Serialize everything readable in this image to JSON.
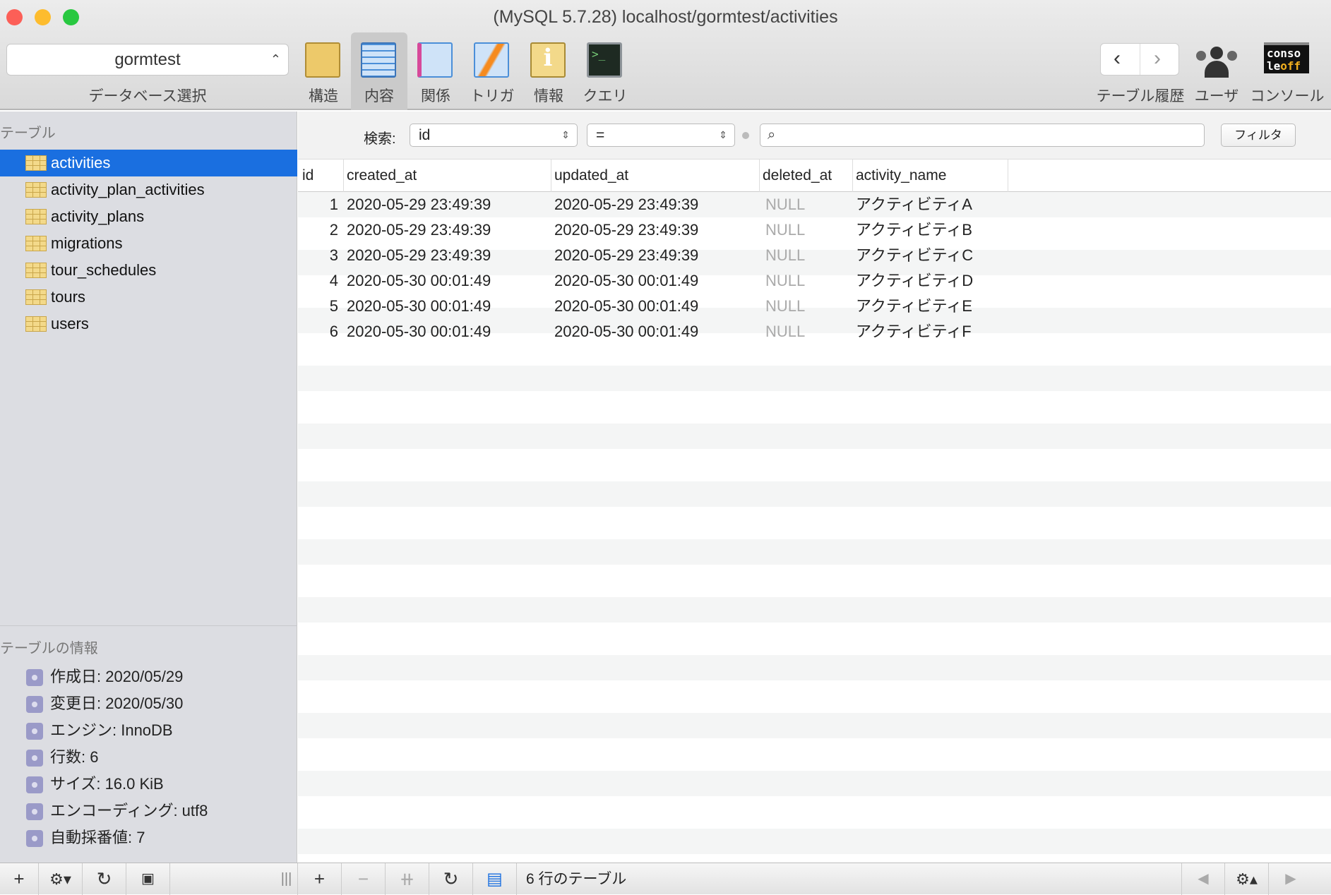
{
  "window": {
    "title": "(MySQL 5.7.28) localhost/gormtest/activities"
  },
  "toolbar": {
    "database": "gormtest",
    "database_label": "データベース選択",
    "buttons": [
      {
        "label": "構造",
        "icon": "structure-icon"
      },
      {
        "label": "内容",
        "icon": "content-icon"
      },
      {
        "label": "関係",
        "icon": "relations-icon"
      },
      {
        "label": "トリガ",
        "icon": "triggers-icon"
      },
      {
        "label": "情報",
        "icon": "info-icon"
      },
      {
        "label": "クエリ",
        "icon": "query-icon"
      }
    ],
    "history_label": "テーブル履歴",
    "users_label": "ユーザ",
    "console_label": "コンソール",
    "console_icon_text": "conso le off"
  },
  "sidebar": {
    "tables_header": "テーブル",
    "tables": [
      "activities",
      "activity_plan_activities",
      "activity_plans",
      "migrations",
      "tour_schedules",
      "tours",
      "users"
    ],
    "info_header": "テーブルの情報",
    "info": [
      "作成日: 2020/05/29",
      "変更日: 2020/05/30",
      "エンジン: InnoDB",
      "行数: 6",
      "サイズ: 16.0 KiB",
      "エンコーディング: utf8",
      "自動採番値: 7"
    ]
  },
  "filter": {
    "label": "検索:",
    "field": "id",
    "operator": "=",
    "search_value": "",
    "button": "フィルタ"
  },
  "table": {
    "columns": [
      "id",
      "created_at",
      "updated_at",
      "deleted_at",
      "activity_name"
    ],
    "rows": [
      [
        "1",
        "2020-05-29 23:49:39",
        "2020-05-29 23:49:39",
        "NULL",
        "アクティビティA"
      ],
      [
        "2",
        "2020-05-29 23:49:39",
        "2020-05-29 23:49:39",
        "NULL",
        "アクティビティB"
      ],
      [
        "3",
        "2020-05-29 23:49:39",
        "2020-05-29 23:49:39",
        "NULL",
        "アクティビティC"
      ],
      [
        "4",
        "2020-05-30 00:01:49",
        "2020-05-30 00:01:49",
        "NULL",
        "アクティビティD"
      ],
      [
        "5",
        "2020-05-30 00:01:49",
        "2020-05-30 00:01:49",
        "NULL",
        "アクティビティE"
      ],
      [
        "6",
        "2020-05-30 00:01:49",
        "2020-05-30 00:01:49",
        "NULL",
        "アクティビティF"
      ]
    ]
  },
  "status": {
    "text": "6 行のテーブル"
  },
  "colors": {
    "selection": "#1a6fe0",
    "sidebar": "#dcdde2"
  }
}
